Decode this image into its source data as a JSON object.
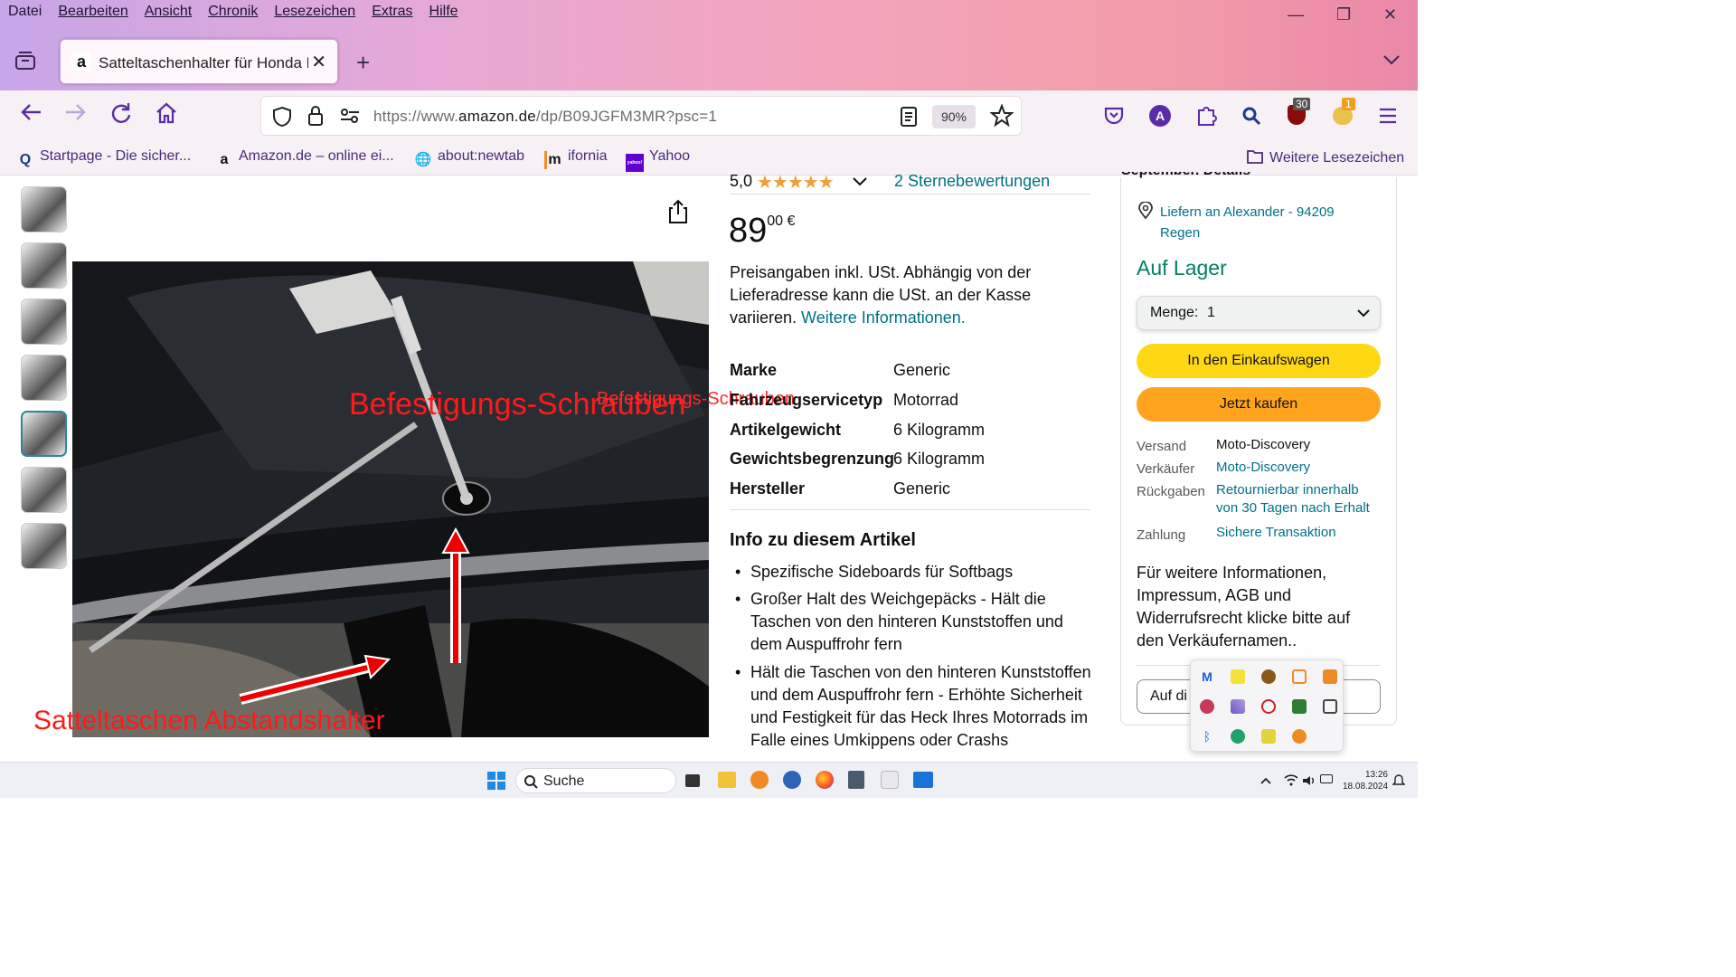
{
  "menu": [
    "Datei",
    "Bearbeiten",
    "Ansicht",
    "Chronik",
    "Lesezeichen",
    "Extras",
    "Hilfe"
  ],
  "window_controls": {
    "minimize": "—",
    "restore": "❐",
    "close": "✕"
  },
  "tab": {
    "favicon": "a",
    "title": "Satteltaschenhalter für Honda N",
    "close": "✕",
    "new_tab": "+"
  },
  "nav": {
    "url_prefix": "https://www.",
    "url_domain": "amazon.de",
    "url_path": "/dp/B09JGFM3MR?psc=1",
    "zoom": "90%",
    "account_initial": "A",
    "ublock_count": "30",
    "ext_count": "1"
  },
  "bookmarks": [
    {
      "label": "Startpage - Die sicher...",
      "icon": "Q"
    },
    {
      "label": "Amazon.de – online ei...",
      "icon": "a"
    },
    {
      "label": "about:newtab",
      "icon": "🌐"
    },
    {
      "label": "ifornia",
      "icon": "m"
    },
    {
      "label": "Yahoo",
      "icon": "yahoo!"
    }
  ],
  "bookmarks_more": "Weitere Lesezeichen",
  "product": {
    "rating": "5,0",
    "stars": "★★★★★",
    "rating_link": "2 Sternebewertungen",
    "price_whole": "89",
    "price_fraction": "00 €",
    "tax_note": "Preisangaben inkl. USt. Abhängig von der Lieferadresse kann die USt. an der Kasse variieren.",
    "more_info": "Weitere Informationen.",
    "specs": [
      {
        "k": "Marke",
        "v": "Generic"
      },
      {
        "k": "Fahrzeugservicetyp",
        "v": "Motorrad"
      },
      {
        "k": "Artikelgewicht",
        "v": "6 Kilogramm"
      },
      {
        "k": "Gewichtsbegrenzung",
        "v": "6 Kilogramm"
      },
      {
        "k": "Hersteller",
        "v": "Generic"
      }
    ],
    "info_heading": "Info zu diesem Artikel",
    "bullets": [
      "Spezifische Sideboards für Softbags",
      "Großer Halt des Weichgepäcks - Hält die Taschen von den hinteren Kunststoffen und dem Auspuffrohr fern",
      "Hält die Taschen von den hinteren Kunststoffen und dem Auspuffrohr fern - Erhöhte Sicherheit und Festigkeit für das Heck Ihres Motorrads im Falle eines Umkippens oder Crashs"
    ]
  },
  "image_annotations": {
    "main": "Befestigungs-Schrauben",
    "ghost": "Befestigungs-Schrauben",
    "bottom": "Satteltaschen Abstandshalter"
  },
  "buybox": {
    "top_cut": "September. Details",
    "deliver_line1": "Liefern an Alexander - 94209",
    "deliver_line2": "Regen",
    "stock": "Auf Lager",
    "qty_label": "Menge:",
    "qty_value": "1",
    "add_to_cart": "In den Einkaufswagen",
    "buy_now": "Jetzt kaufen",
    "rows": [
      {
        "k": "Versand",
        "v": "Moto-Discovery"
      },
      {
        "k": "Verkäufer",
        "v": "Moto-Discovery"
      },
      {
        "k": "Rückgaben",
        "v": "Retournierbar innerhalb von 30 Tagen nach Erhalt"
      },
      {
        "k": "Zahlung",
        "v": "Sichere Transaktion"
      }
    ],
    "seller_note": "Für weitere Informationen, Impressum, AGB und Widerrufsrecht klicke bitte auf den Verkäufernamen..",
    "list_btn": "Auf di"
  },
  "taskbar": {
    "search": "Suche",
    "time": "13:26",
    "date": "18.08.2024"
  },
  "colors": {
    "accent": "#5b2ca8",
    "amazon_link": "#007185",
    "stock_green": "#067d62",
    "cart_yellow": "#ffd814",
    "buy_orange": "#ffa41c",
    "annotation_red": "#ff1a1a"
  }
}
